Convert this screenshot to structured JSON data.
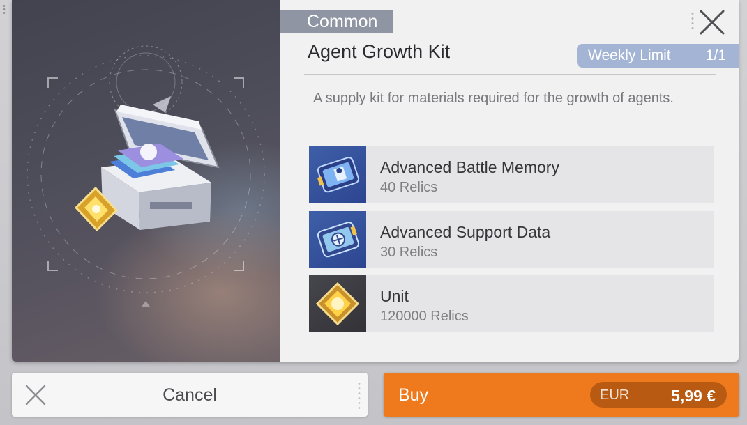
{
  "item": {
    "rarity": "Common",
    "title": "Agent Growth Kit",
    "weekly_limit_label": "Weekly Limit",
    "weekly_limit_count": "1/1",
    "description": "A supply kit for materials required for the growth of agents."
  },
  "contents": [
    {
      "name": "Advanced Battle Memory",
      "quantity": "40 Relics",
      "icon": "battle-memory-chip-icon"
    },
    {
      "name": "Advanced Support Data",
      "quantity": "30 Relics",
      "icon": "support-data-chip-icon"
    },
    {
      "name": "Unit",
      "quantity": "120000 Relics",
      "icon": "unit-gold-gem-icon"
    }
  ],
  "actions": {
    "cancel_label": "Cancel",
    "buy_label": "Buy",
    "currency": "EUR",
    "price": "5,99 €"
  },
  "colors": {
    "buy": "#ef7a1e",
    "price_pill": "#b85a12",
    "rarity_tag": "#8f95a3",
    "weekly_limit": "#a3b4d4"
  }
}
